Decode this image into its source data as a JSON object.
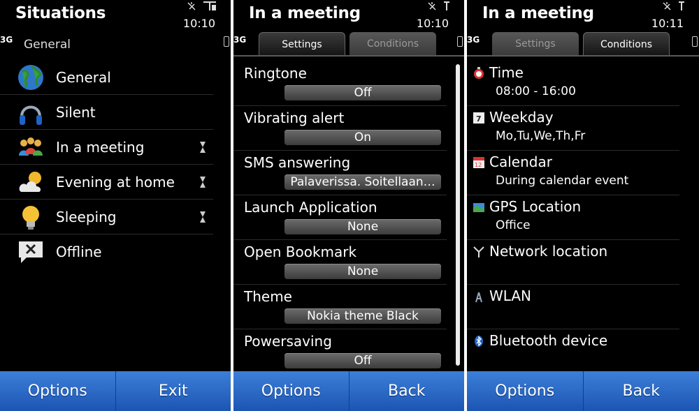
{
  "screens": {
    "situations": {
      "title": "Situations",
      "time": "10:10",
      "network": "3G",
      "subtitle": "General",
      "items": [
        {
          "label": "General",
          "icon": "globe-icon",
          "timed": false
        },
        {
          "label": "Silent",
          "icon": "headphones-icon",
          "timed": false
        },
        {
          "label": "In a meeting",
          "icon": "people-icon",
          "timed": true
        },
        {
          "label": "Evening at home",
          "icon": "cloud-sun-icon",
          "timed": true
        },
        {
          "label": "Sleeping",
          "icon": "lightbulb-icon",
          "timed": true
        },
        {
          "label": "Offline",
          "icon": "offline-bubble-icon",
          "timed": false
        }
      ],
      "softkeys": {
        "left": "Options",
        "right": "Exit"
      }
    },
    "settings": {
      "title": "In a meeting",
      "time": "10:10",
      "network": "3G",
      "tabs": [
        {
          "label": "Settings",
          "active": true
        },
        {
          "label": "Conditions",
          "active": false
        }
      ],
      "items": [
        {
          "label": "Ringtone",
          "value": "Off"
        },
        {
          "label": "Vibrating alert",
          "value": "On"
        },
        {
          "label": "SMS answering",
          "value": "Palaverissa. Soitellaan…"
        },
        {
          "label": "Launch Application",
          "value": "None"
        },
        {
          "label": "Open Bookmark",
          "value": "None"
        },
        {
          "label": "Theme",
          "value": "Nokia theme Black"
        },
        {
          "label": "Powersaving",
          "value": "Off"
        }
      ],
      "softkeys": {
        "left": "Options",
        "right": "Back"
      }
    },
    "conditions": {
      "title": "In a meeting",
      "time": "10:11",
      "network": "3G",
      "tabs": [
        {
          "label": "Settings",
          "active": false
        },
        {
          "label": "Conditions",
          "active": true
        }
      ],
      "items": [
        {
          "label": "Time",
          "value": "08:00 - 16:00",
          "icon": "stopwatch-icon"
        },
        {
          "label": "Weekday",
          "value": "Mo,Tu,We,Th,Fr",
          "icon": "weekday-calendar-icon"
        },
        {
          "label": "Calendar",
          "value": "During calendar event",
          "icon": "calendar-icon"
        },
        {
          "label": "GPS Location",
          "value": "Office",
          "icon": "gps-map-icon"
        },
        {
          "label": "Network location",
          "value": "",
          "icon": "antenna-icon"
        },
        {
          "label": "WLAN",
          "value": "",
          "icon": "wlan-icon"
        },
        {
          "label": "Bluetooth device",
          "value": "",
          "icon": "bluetooth-icon"
        }
      ],
      "softkeys": {
        "left": "Options",
        "right": "Back"
      }
    }
  }
}
